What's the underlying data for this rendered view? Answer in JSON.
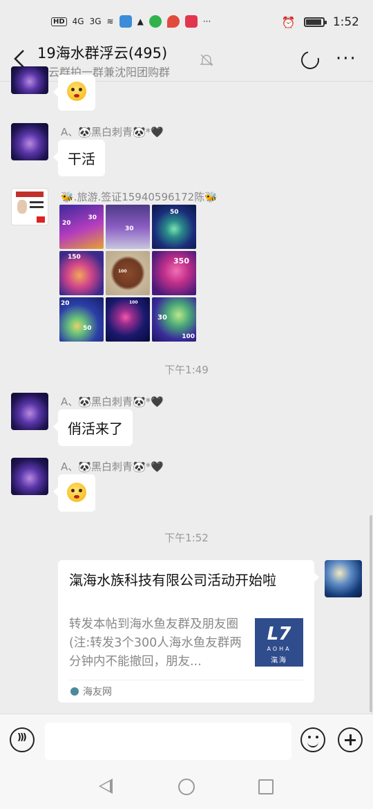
{
  "status_bar": {
    "hd_badge": "HD",
    "signal_1": "4G",
    "signal_2": "3G",
    "time": "1:52",
    "more": "···"
  },
  "header": {
    "title": "19海水群浮云(495)",
    "subtitle": "浮云群拍一群兼沈阳团购群",
    "more_label": "···"
  },
  "messages": [
    {
      "sender": "A、🐼黑白刺青🐼*🖤",
      "text": "干活"
    },
    {
      "sender": "🐝.旅游.签证15940596172陈🐝"
    },
    {
      "sender": "A、🐼黑白刺青🐼*🖤",
      "text": "俏活来了"
    },
    {
      "sender": "A、🐼黑白刺青🐼*🖤"
    }
  ],
  "times": [
    "下午1:49",
    "下午1:52"
  ],
  "photo_labels": [
    "20",
    "30",
    "30",
    "50",
    "150",
    "100",
    "350",
    "20",
    "50",
    "100",
    "30",
    "100"
  ],
  "link_card": {
    "title": "滊海水族科技有限公司活动开始啦",
    "description": "转发本帖到海水鱼友群及朋友圈(注:转发3个300人海水鱼友群两分钟内不能撤回，朋友...",
    "logo_text": "L7",
    "logo_sub": "AOHA",
    "logo_cn": "滊海",
    "source": "海友网"
  },
  "colors": {
    "background": "#ededed",
    "bubble": "#ffffff",
    "muted_text": "#888888",
    "link_thumb": "#2f4c8c"
  }
}
